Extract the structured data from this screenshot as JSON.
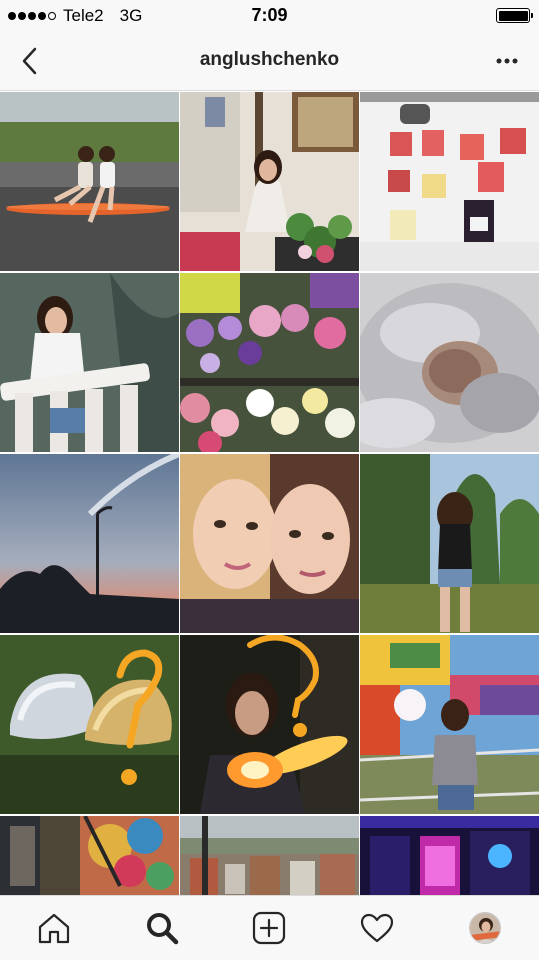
{
  "status_bar": {
    "signal_dots_filled": 4,
    "signal_dots_total": 5,
    "carrier": "Tele2",
    "network": "3G",
    "time": "7:09",
    "battery_level": 1.0
  },
  "nav": {
    "back_icon": "chevron-left-icon",
    "title": "anglushchenko",
    "more_icon": "more-horizontal-icon"
  },
  "grid": {
    "columns": 3,
    "posts": [
      {
        "name": "post-longboard-friends"
      },
      {
        "name": "post-girl-with-flowers"
      },
      {
        "name": "post-fruit-cups"
      },
      {
        "name": "post-balcony-girl"
      },
      {
        "name": "post-flower-market"
      },
      {
        "name": "post-cat-paw"
      },
      {
        "name": "post-sunset-streetlight"
      },
      {
        "name": "post-selfie-friends"
      },
      {
        "name": "post-park-girl"
      },
      {
        "name": "post-sculpture-question"
      },
      {
        "name": "post-night-sparkler"
      },
      {
        "name": "post-fair-cotton-candy"
      },
      {
        "name": "post-graffiti-wall"
      },
      {
        "name": "post-city-view"
      },
      {
        "name": "post-neon-lights"
      }
    ]
  },
  "tab_bar": {
    "tabs": [
      {
        "icon": "home-icon",
        "active": false
      },
      {
        "icon": "search-icon",
        "active": true
      },
      {
        "icon": "add-post-icon",
        "active": false
      },
      {
        "icon": "heart-icon",
        "active": false
      },
      {
        "icon": "profile-avatar-icon",
        "active": false
      }
    ]
  },
  "colors": {
    "bar_background": "#f8f8f8",
    "divider": "#dbdbdb",
    "icon": "#262626",
    "accent_orange": "#f5a623"
  }
}
